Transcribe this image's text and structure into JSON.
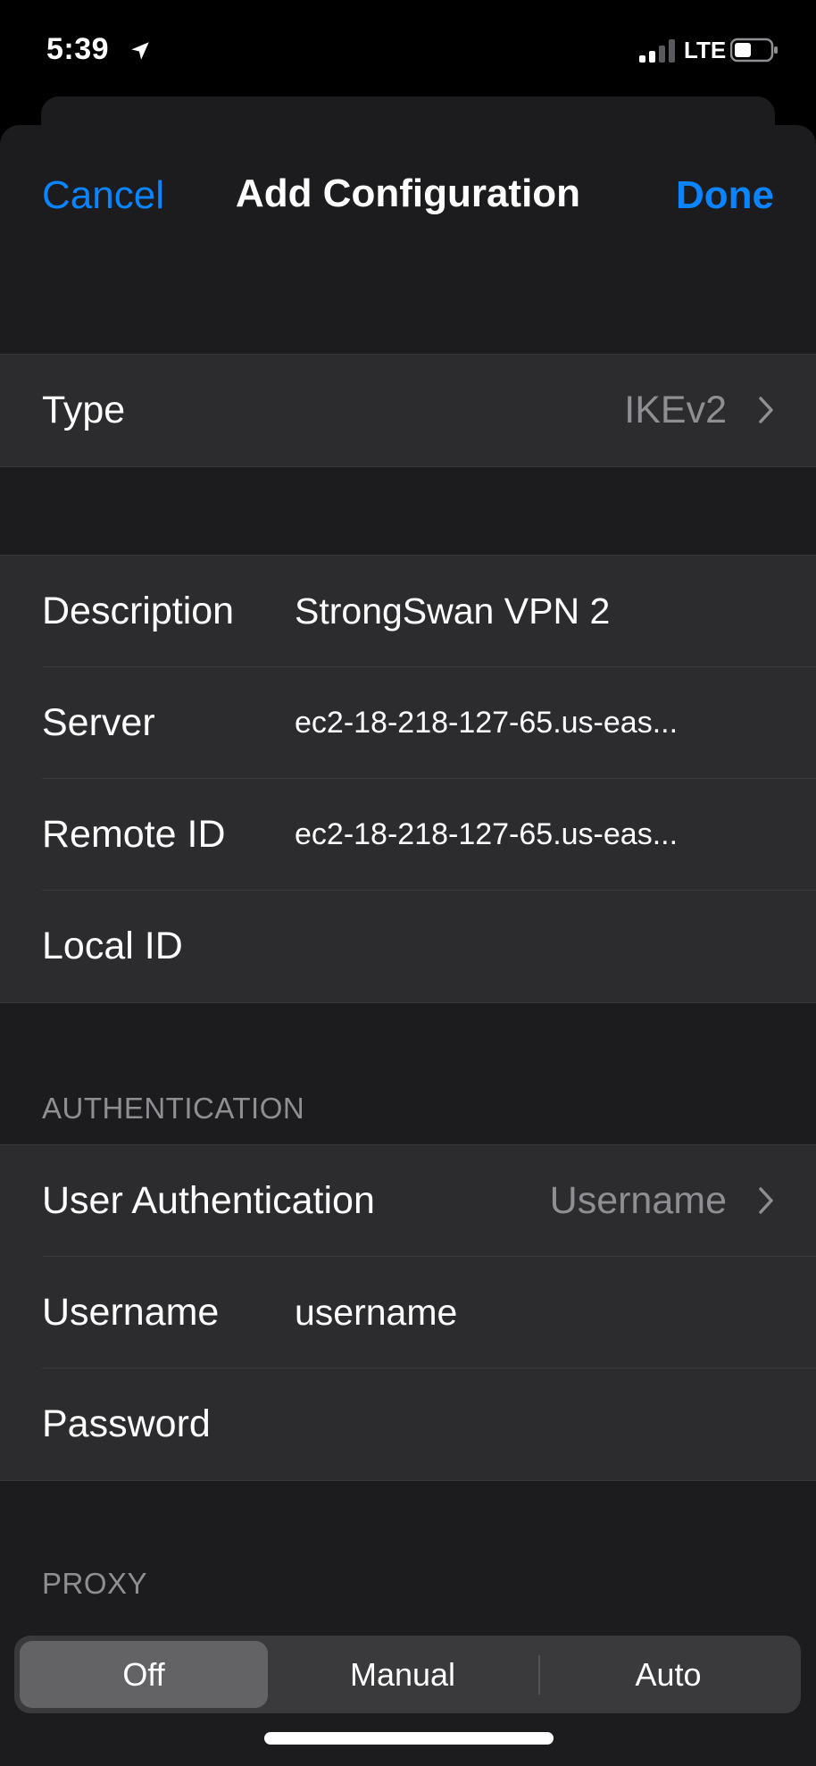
{
  "status_bar": {
    "time": "5:39",
    "network": "LTE"
  },
  "nav": {
    "cancel_label": "Cancel",
    "title": "Add Configuration",
    "done_label": "Done"
  },
  "type_row": {
    "label": "Type",
    "value": "IKEv2"
  },
  "config": {
    "description": {
      "label": "Description",
      "value": "StrongSwan VPN 2"
    },
    "server": {
      "label": "Server",
      "value": "ec2-18-218-127-65.us-eas..."
    },
    "remote_id": {
      "label": "Remote ID",
      "value": "ec2-18-218-127-65.us-eas..."
    },
    "local_id": {
      "label": "Local ID",
      "value": ""
    }
  },
  "authentication": {
    "header": "AUTHENTICATION",
    "user_auth": {
      "label": "User Authentication",
      "value": "Username"
    },
    "username": {
      "label": "Username",
      "value": "username"
    },
    "password": {
      "label": "Password",
      "value": ""
    }
  },
  "proxy": {
    "header": "PROXY",
    "options": [
      "Off",
      "Manual",
      "Auto"
    ],
    "selected": "Off"
  },
  "colors": {
    "accent": "#0a84ff",
    "background": "#1c1c1e",
    "cell": "#2c2c2e",
    "secondary_text": "#8e8e93"
  }
}
